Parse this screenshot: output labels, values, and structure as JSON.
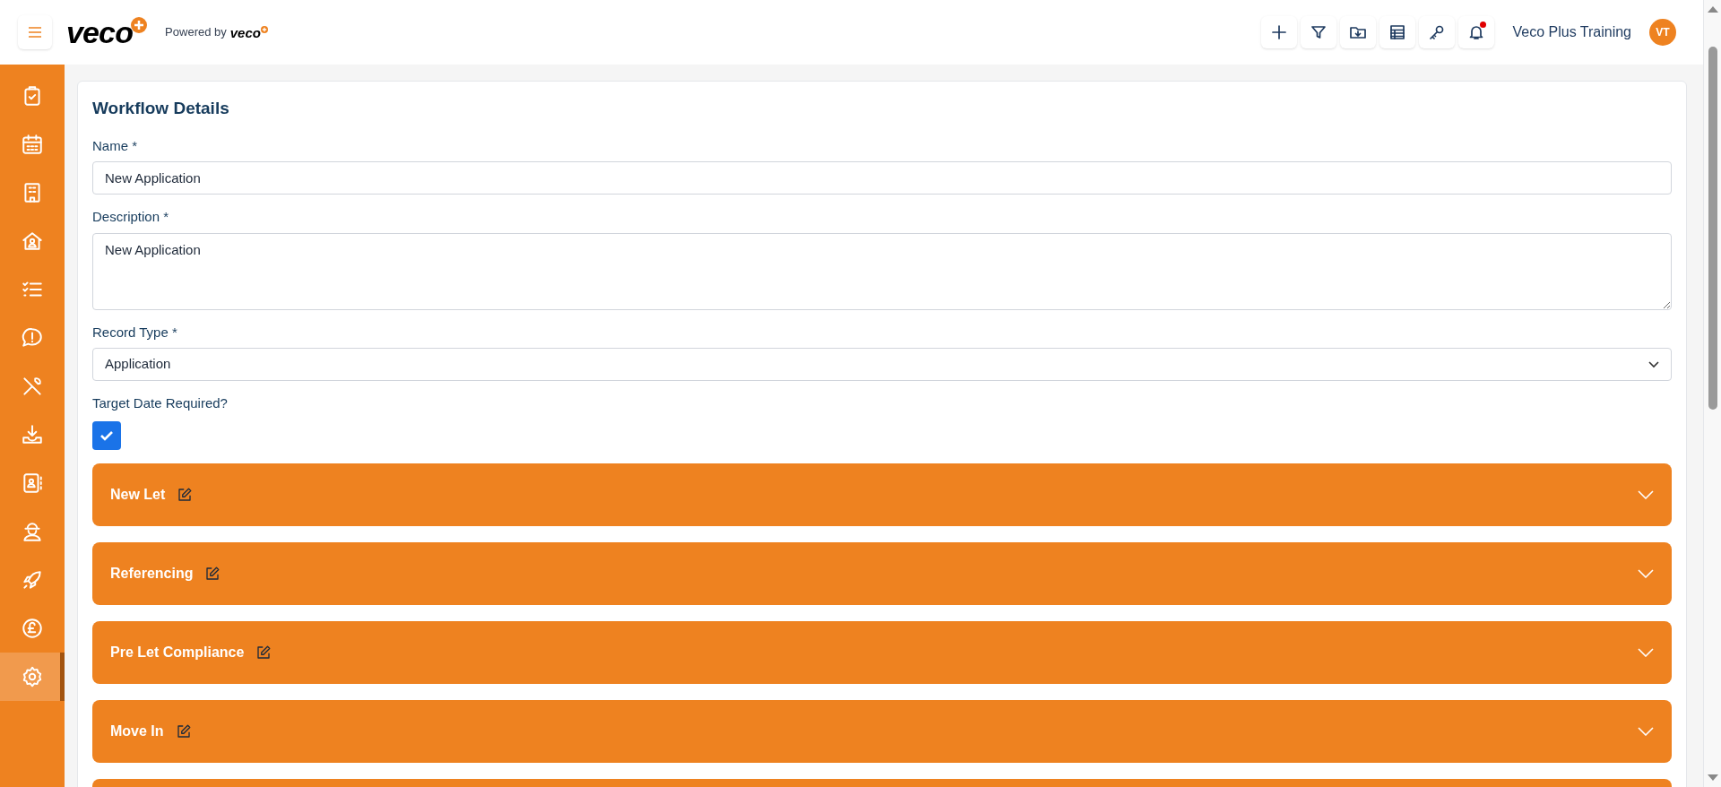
{
  "header": {
    "logo": "veco",
    "powered_by": "Powered by",
    "powered_logo": "veco",
    "toolbar": [
      {
        "kind": "plus"
      },
      {
        "kind": "filter"
      },
      {
        "kind": "folder"
      },
      {
        "kind": "table"
      },
      {
        "kind": "key"
      },
      {
        "kind": "bell",
        "notification": true
      }
    ],
    "user_name": "Veco Plus Training",
    "avatar": "VT"
  },
  "sidebar": {
    "items": [
      {
        "kind": "clipboard",
        "selected": false
      },
      {
        "kind": "calendar",
        "selected": false
      },
      {
        "kind": "building",
        "selected": false
      },
      {
        "kind": "house",
        "selected": false
      },
      {
        "kind": "checklist",
        "selected": false
      },
      {
        "kind": "alert",
        "selected": false
      },
      {
        "kind": "tools",
        "selected": false
      },
      {
        "kind": "download",
        "selected": false
      },
      {
        "kind": "contacts",
        "selected": false
      },
      {
        "kind": "worker",
        "selected": false
      },
      {
        "kind": "rocket",
        "selected": false
      },
      {
        "kind": "pound",
        "selected": false
      },
      {
        "kind": "gear",
        "selected": true
      }
    ]
  },
  "form": {
    "title": "Workflow Details",
    "name": {
      "label": "Name *",
      "value": "New Application"
    },
    "description": {
      "label": "Description *",
      "value": "New Application"
    },
    "record_type": {
      "label": "Record Type *",
      "value": "Application"
    },
    "target_date": {
      "label": "Target Date Required?",
      "checked": true
    },
    "sections": [
      {
        "title": "New Let",
        "expanded": false
      },
      {
        "title": "Referencing",
        "expanded": false
      },
      {
        "title": "Pre Let Compliance",
        "expanded": false
      },
      {
        "title": "Move In",
        "expanded": false
      }
    ]
  }
}
